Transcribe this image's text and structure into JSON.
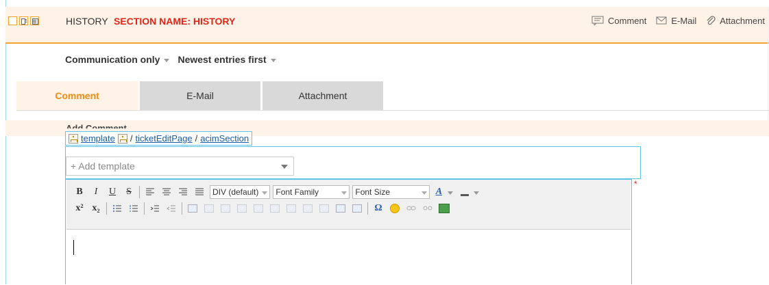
{
  "header": {
    "title": "HISTORY",
    "section_label": "SECTION NAME: HISTORY",
    "view_icons": [
      "view-collapsed-icon",
      "view-split-icon",
      "view-detail-icon"
    ],
    "actions": [
      {
        "label": "Comment",
        "icon": "comment-icon"
      },
      {
        "label": "E-Mail",
        "icon": "mail-icon"
      },
      {
        "label": "Attachment",
        "icon": "paperclip-icon"
      }
    ],
    "colors": {
      "background": "#fef3e6",
      "accent": "#f0a330",
      "section": "#e0261b"
    }
  },
  "filters": {
    "type": "Communication only",
    "order": "Newest entries first"
  },
  "tabs": [
    {
      "label": "Comment",
      "active": true
    },
    {
      "label": "E-Mail",
      "active": false
    },
    {
      "label": "Attachment",
      "active": false
    }
  ],
  "add_comment": {
    "label": "Add Comment",
    "path": {
      "template": "template",
      "sep": "/",
      "page": "ticketEditPage",
      "section": "acimSection"
    },
    "template_select_placeholder": "+ Add template",
    "required_marker": "*"
  },
  "editor": {
    "toolbar_row1": {
      "bold": "B",
      "italic": "I",
      "underline": "U",
      "strike": "S",
      "format": "DIV (default)",
      "font_family": "Font Family",
      "font_size": "Font Size",
      "text_color": "A"
    },
    "toolbar_row2": {
      "superscript": "x²",
      "subscript": "x₂",
      "special_char": "Ω"
    },
    "content": ""
  }
}
